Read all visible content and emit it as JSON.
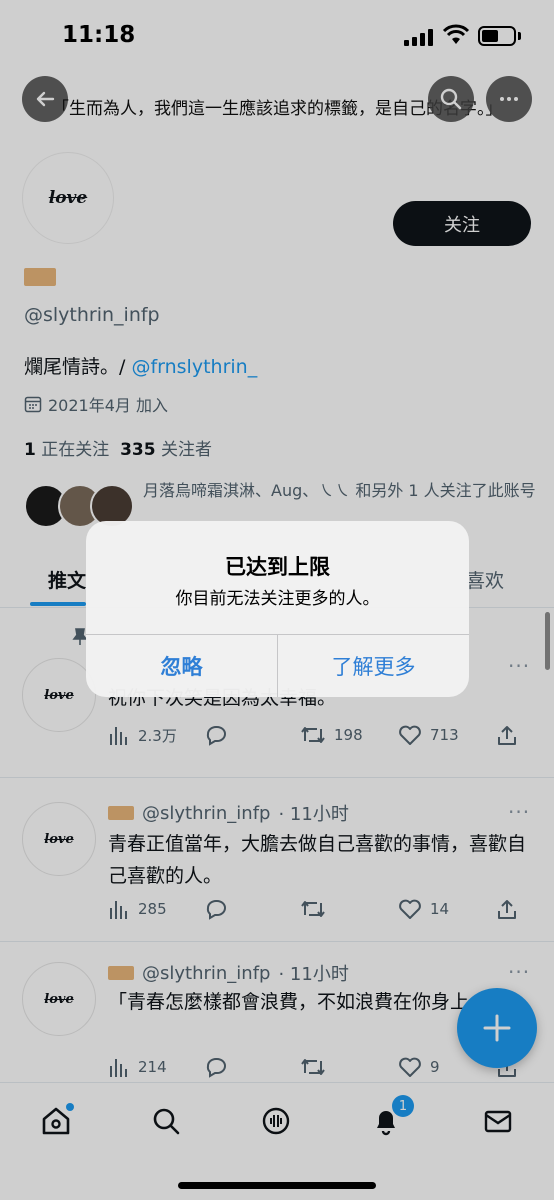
{
  "status_bar": {
    "time": "11:18"
  },
  "header": {
    "bio_banner": "「生而為人，我們這一生應該追求的標籤，是自己的名字。」"
  },
  "profile": {
    "avatar_text": "love",
    "follow_label": "关注",
    "handle": "@slythrin_infp",
    "bio": "爛尾情詩。/ ",
    "bio_link": "@frnslythrin_",
    "joined": "2021年4月 加入",
    "following_count": "1",
    "following_label": " 正在关注  ",
    "followers_count": "335",
    "followers_label": " 关注者",
    "followed_by": "月落烏啼霜淇淋、Aug、㇏㇏ 和另外 1 人关注了此账号"
  },
  "tabs": {
    "tweets": "推文",
    "likes": "喜欢"
  },
  "tweets": [
    {
      "text": "祝你下次笑是因為太幸福。",
      "views": "2.3万",
      "replies": "",
      "retweets": "198",
      "likes": "713"
    },
    {
      "name": "@slythrin_infp",
      "time": "· 11小时",
      "text": "青春正值當年，大膽去做自己喜歡的事情，喜歡自己喜歡的人。",
      "views": "285",
      "replies": "",
      "retweets": "",
      "likes": "14"
    },
    {
      "name": "@slythrin_infp",
      "time": "· 11小时",
      "text": "「青春怎麼樣都會浪費，不如浪費在你身上。」",
      "views": "214",
      "replies": "",
      "retweets": "",
      "likes": "9"
    }
  ],
  "nav": {
    "notifications_badge": "1"
  },
  "alert": {
    "title": "已达到上限",
    "message": "你目前无法关注更多的人。",
    "ignore_label": "忽略",
    "learn_more_label": "了解更多"
  },
  "colors": {
    "accent": "#1d9bf0",
    "alert_button": "#2f7fd6",
    "follow_button": "#0f1419"
  }
}
